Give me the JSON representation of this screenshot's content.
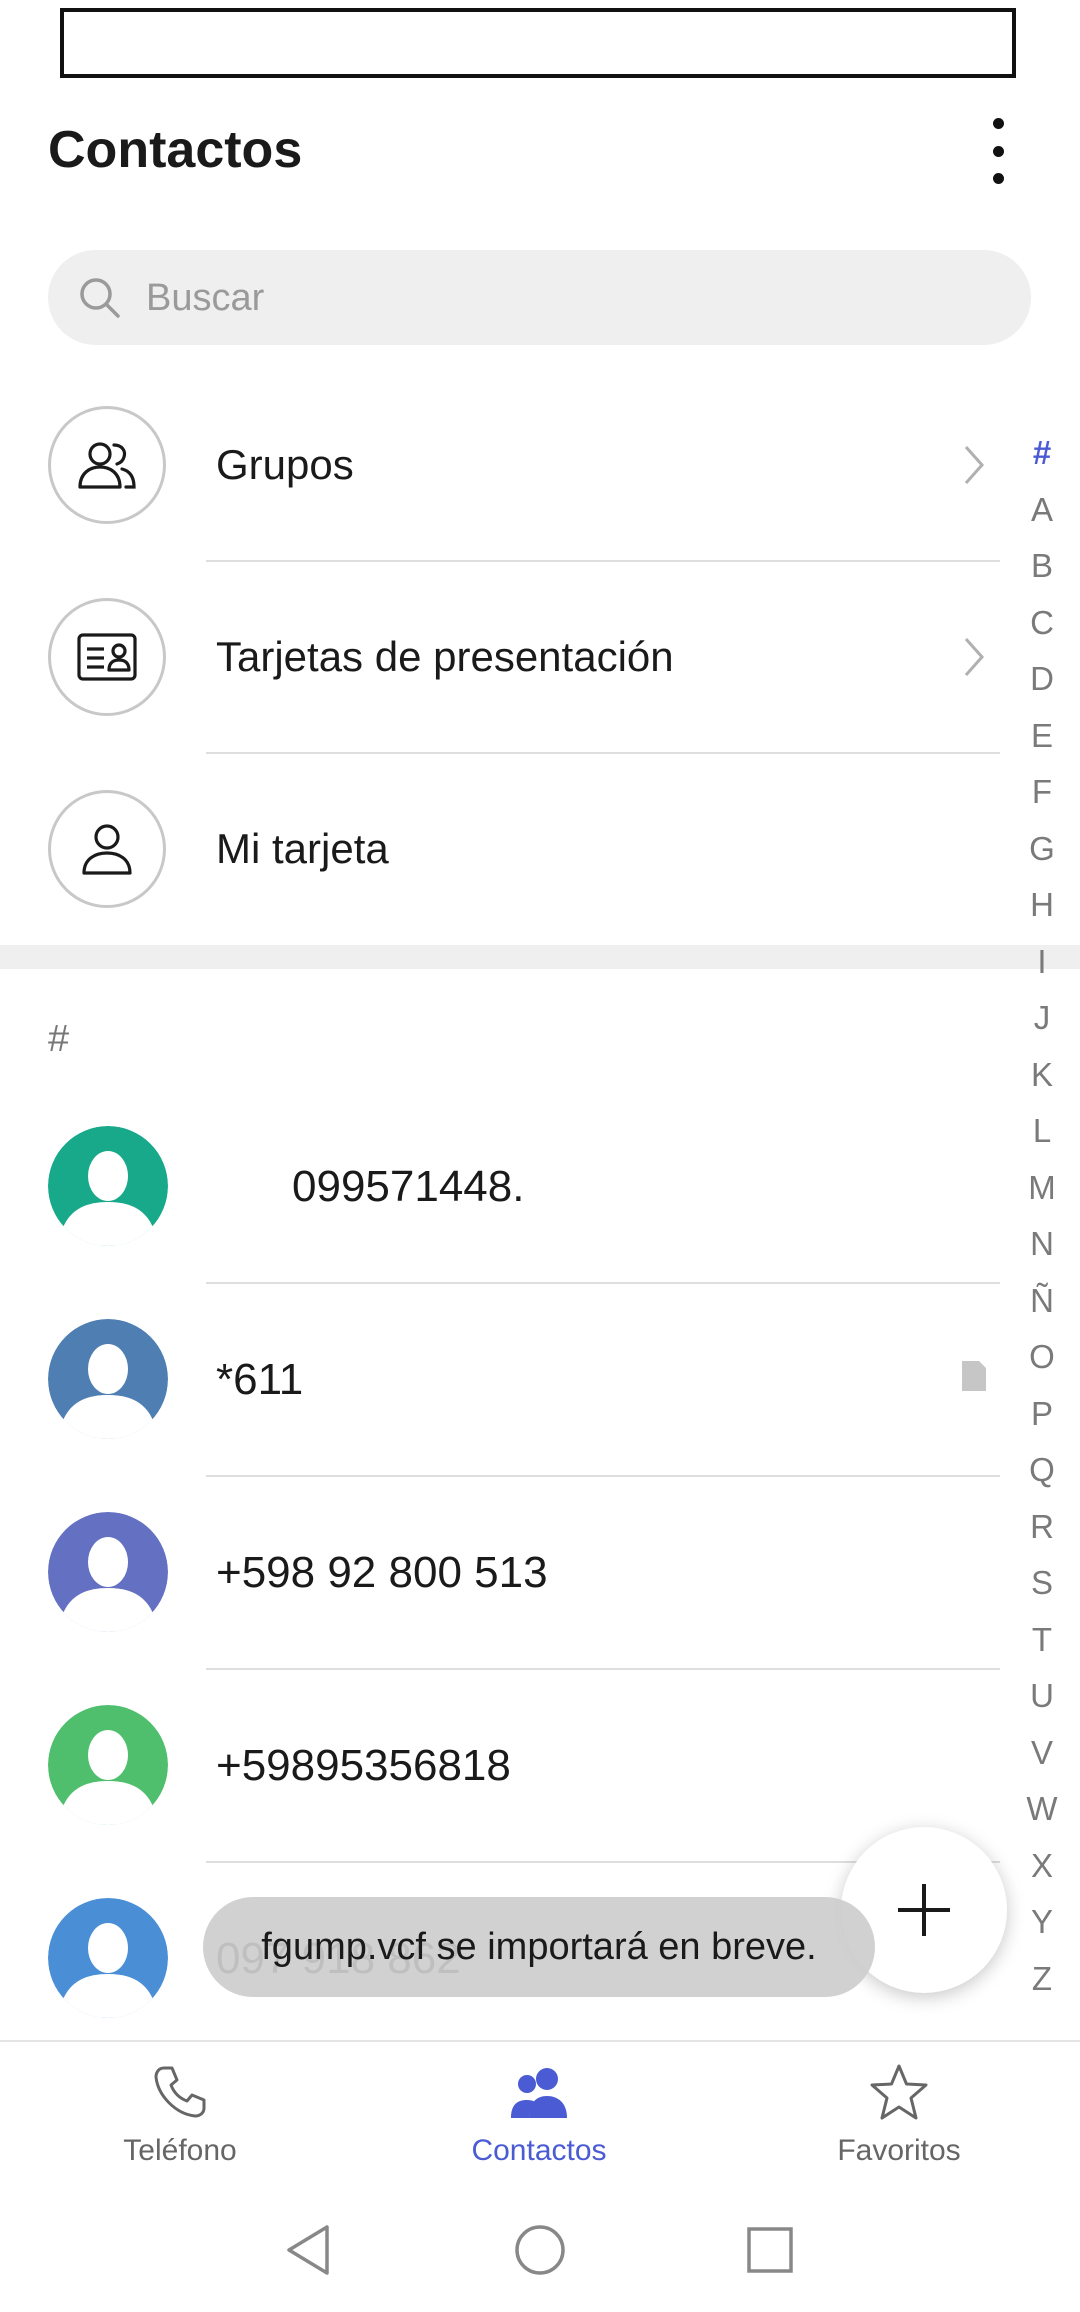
{
  "header": {
    "title": "Contactos",
    "more_icon": "more-vertical-icon"
  },
  "search": {
    "placeholder": "Buscar",
    "value": ""
  },
  "menu": [
    {
      "label": "Grupos",
      "icon": "groups-icon"
    },
    {
      "label": "Tarjetas de presentación",
      "icon": "business-card-icon"
    },
    {
      "label": "Mi tarjeta",
      "icon": "person-icon"
    }
  ],
  "section_header": "#",
  "contacts": [
    {
      "name": "099571448.",
      "avatar_color": "#17a98a"
    },
    {
      "name": "*611",
      "avatar_color": "#4f7fb2"
    },
    {
      "name": "+598 92 800 513",
      "avatar_color": "#6470c2"
    },
    {
      "name": "+59895356818",
      "avatar_color": "#4fbf6e"
    },
    {
      "name": "097 918 862",
      "avatar_color": "#4a8fd6"
    }
  ],
  "alphabet": [
    "#",
    "A",
    "B",
    "C",
    "D",
    "E",
    "F",
    "G",
    "H",
    "I",
    "J",
    "K",
    "L",
    "M",
    "N",
    "Ñ",
    "O",
    "P",
    "Q",
    "R",
    "S",
    "T",
    "U",
    "V",
    "W",
    "X",
    "Y",
    "Z"
  ],
  "toast": "fgump.vcf se importará en breve.",
  "bottom_nav": {
    "phone": "Teléfono",
    "contacts": "Contactos",
    "favorites": "Favoritos"
  },
  "colors": {
    "accent": "#4a5bd4",
    "divider": "#dedede",
    "search_bg": "#efefef"
  }
}
